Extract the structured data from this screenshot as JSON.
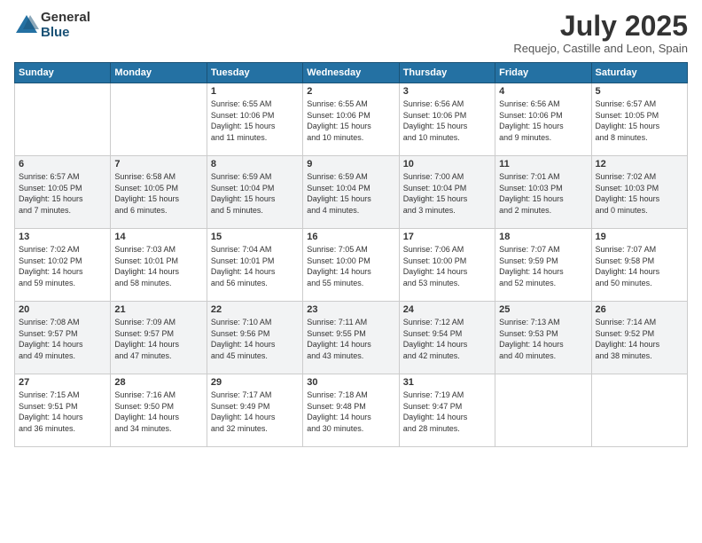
{
  "logo": {
    "general": "General",
    "blue": "Blue"
  },
  "title": "July 2025",
  "location": "Requejo, Castille and Leon, Spain",
  "days_of_week": [
    "Sunday",
    "Monday",
    "Tuesday",
    "Wednesday",
    "Thursday",
    "Friday",
    "Saturday"
  ],
  "weeks": [
    [
      {
        "day": "",
        "info": ""
      },
      {
        "day": "",
        "info": ""
      },
      {
        "day": "1",
        "info": "Sunrise: 6:55 AM\nSunset: 10:06 PM\nDaylight: 15 hours\nand 11 minutes."
      },
      {
        "day": "2",
        "info": "Sunrise: 6:55 AM\nSunset: 10:06 PM\nDaylight: 15 hours\nand 10 minutes."
      },
      {
        "day": "3",
        "info": "Sunrise: 6:56 AM\nSunset: 10:06 PM\nDaylight: 15 hours\nand 10 minutes."
      },
      {
        "day": "4",
        "info": "Sunrise: 6:56 AM\nSunset: 10:06 PM\nDaylight: 15 hours\nand 9 minutes."
      },
      {
        "day": "5",
        "info": "Sunrise: 6:57 AM\nSunset: 10:05 PM\nDaylight: 15 hours\nand 8 minutes."
      }
    ],
    [
      {
        "day": "6",
        "info": "Sunrise: 6:57 AM\nSunset: 10:05 PM\nDaylight: 15 hours\nand 7 minutes."
      },
      {
        "day": "7",
        "info": "Sunrise: 6:58 AM\nSunset: 10:05 PM\nDaylight: 15 hours\nand 6 minutes."
      },
      {
        "day": "8",
        "info": "Sunrise: 6:59 AM\nSunset: 10:04 PM\nDaylight: 15 hours\nand 5 minutes."
      },
      {
        "day": "9",
        "info": "Sunrise: 6:59 AM\nSunset: 10:04 PM\nDaylight: 15 hours\nand 4 minutes."
      },
      {
        "day": "10",
        "info": "Sunrise: 7:00 AM\nSunset: 10:04 PM\nDaylight: 15 hours\nand 3 minutes."
      },
      {
        "day": "11",
        "info": "Sunrise: 7:01 AM\nSunset: 10:03 PM\nDaylight: 15 hours\nand 2 minutes."
      },
      {
        "day": "12",
        "info": "Sunrise: 7:02 AM\nSunset: 10:03 PM\nDaylight: 15 hours\nand 0 minutes."
      }
    ],
    [
      {
        "day": "13",
        "info": "Sunrise: 7:02 AM\nSunset: 10:02 PM\nDaylight: 14 hours\nand 59 minutes."
      },
      {
        "day": "14",
        "info": "Sunrise: 7:03 AM\nSunset: 10:01 PM\nDaylight: 14 hours\nand 58 minutes."
      },
      {
        "day": "15",
        "info": "Sunrise: 7:04 AM\nSunset: 10:01 PM\nDaylight: 14 hours\nand 56 minutes."
      },
      {
        "day": "16",
        "info": "Sunrise: 7:05 AM\nSunset: 10:00 PM\nDaylight: 14 hours\nand 55 minutes."
      },
      {
        "day": "17",
        "info": "Sunrise: 7:06 AM\nSunset: 10:00 PM\nDaylight: 14 hours\nand 53 minutes."
      },
      {
        "day": "18",
        "info": "Sunrise: 7:07 AM\nSunset: 9:59 PM\nDaylight: 14 hours\nand 52 minutes."
      },
      {
        "day": "19",
        "info": "Sunrise: 7:07 AM\nSunset: 9:58 PM\nDaylight: 14 hours\nand 50 minutes."
      }
    ],
    [
      {
        "day": "20",
        "info": "Sunrise: 7:08 AM\nSunset: 9:57 PM\nDaylight: 14 hours\nand 49 minutes."
      },
      {
        "day": "21",
        "info": "Sunrise: 7:09 AM\nSunset: 9:57 PM\nDaylight: 14 hours\nand 47 minutes."
      },
      {
        "day": "22",
        "info": "Sunrise: 7:10 AM\nSunset: 9:56 PM\nDaylight: 14 hours\nand 45 minutes."
      },
      {
        "day": "23",
        "info": "Sunrise: 7:11 AM\nSunset: 9:55 PM\nDaylight: 14 hours\nand 43 minutes."
      },
      {
        "day": "24",
        "info": "Sunrise: 7:12 AM\nSunset: 9:54 PM\nDaylight: 14 hours\nand 42 minutes."
      },
      {
        "day": "25",
        "info": "Sunrise: 7:13 AM\nSunset: 9:53 PM\nDaylight: 14 hours\nand 40 minutes."
      },
      {
        "day": "26",
        "info": "Sunrise: 7:14 AM\nSunset: 9:52 PM\nDaylight: 14 hours\nand 38 minutes."
      }
    ],
    [
      {
        "day": "27",
        "info": "Sunrise: 7:15 AM\nSunset: 9:51 PM\nDaylight: 14 hours\nand 36 minutes."
      },
      {
        "day": "28",
        "info": "Sunrise: 7:16 AM\nSunset: 9:50 PM\nDaylight: 14 hours\nand 34 minutes."
      },
      {
        "day": "29",
        "info": "Sunrise: 7:17 AM\nSunset: 9:49 PM\nDaylight: 14 hours\nand 32 minutes."
      },
      {
        "day": "30",
        "info": "Sunrise: 7:18 AM\nSunset: 9:48 PM\nDaylight: 14 hours\nand 30 minutes."
      },
      {
        "day": "31",
        "info": "Sunrise: 7:19 AM\nSunset: 9:47 PM\nDaylight: 14 hours\nand 28 minutes."
      },
      {
        "day": "",
        "info": ""
      },
      {
        "day": "",
        "info": ""
      }
    ]
  ]
}
